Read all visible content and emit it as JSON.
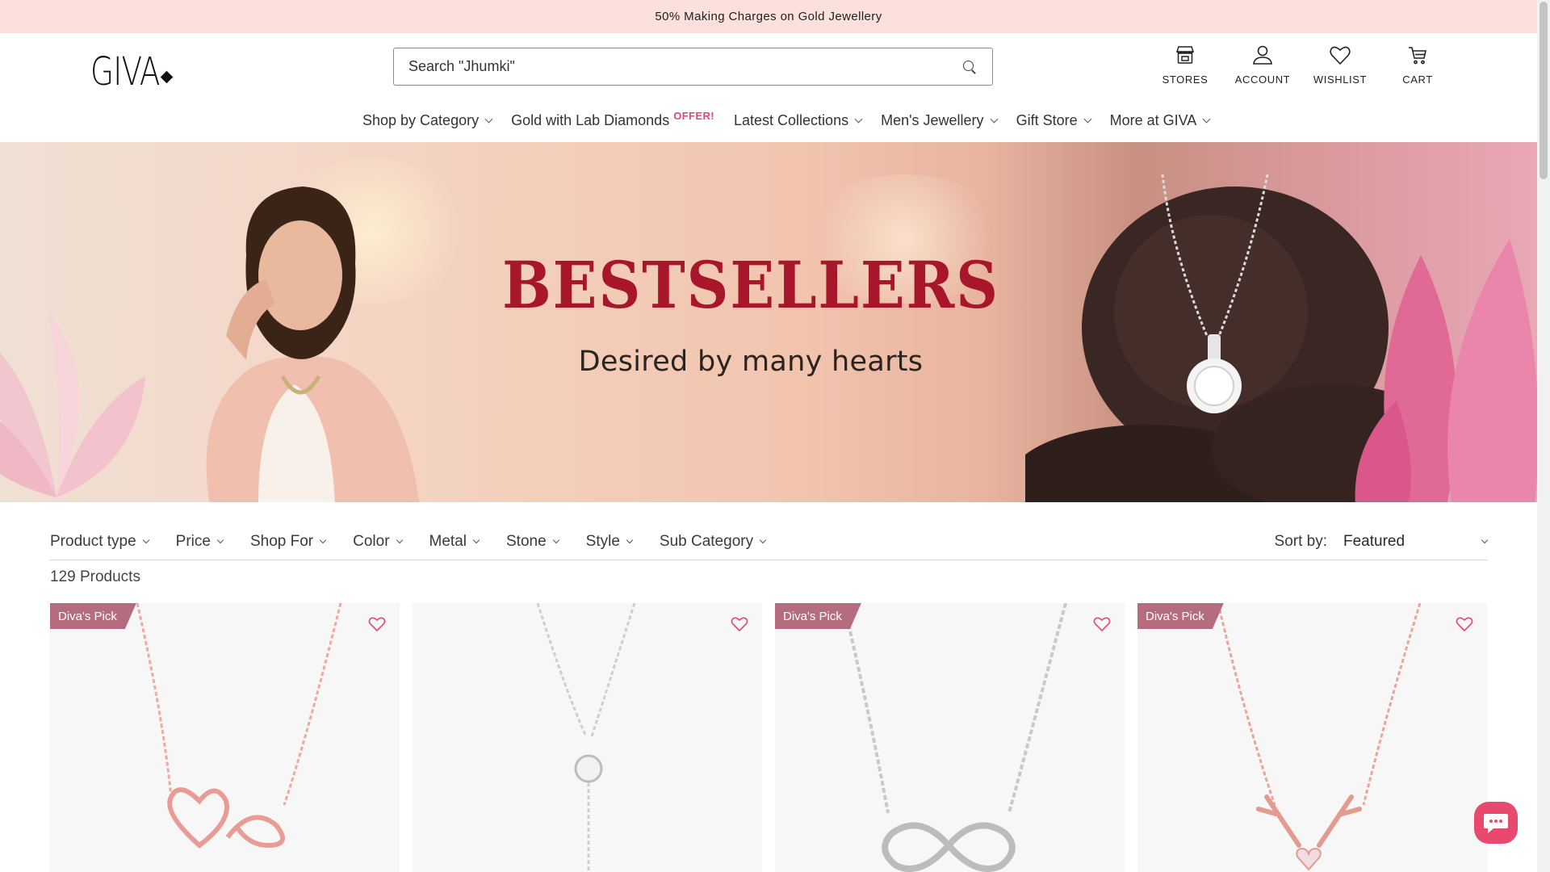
{
  "announcement": "50% Making Charges on Gold Jewellery",
  "brand": {
    "logo_text": "GIVA"
  },
  "search": {
    "placeholder": "Search \"Jhumki\""
  },
  "header_icons": [
    {
      "label": "STORES",
      "icon": "store-icon"
    },
    {
      "label": "ACCOUNT",
      "icon": "user-icon"
    },
    {
      "label": "WISHLIST",
      "icon": "heart-icon"
    },
    {
      "label": "CART",
      "icon": "cart-icon"
    }
  ],
  "nav": [
    {
      "label": "Shop by Category"
    },
    {
      "label": "Gold with Lab Diamonds",
      "tag": "OFFER!"
    },
    {
      "label": "Latest Collections"
    },
    {
      "label": "Men's Jewellery"
    },
    {
      "label": "Gift Store"
    },
    {
      "label": "More at GIVA"
    }
  ],
  "hero": {
    "title": "BESTSELLERS",
    "subtitle": "Desired by many hearts"
  },
  "filters": [
    "Product type",
    "Price",
    "Shop For",
    "Color",
    "Metal",
    "Stone",
    "Style",
    "Sub Category"
  ],
  "sort": {
    "label": "Sort by:",
    "value": "Featured"
  },
  "product_count": "129 Products",
  "products": [
    {
      "badge": "Diva's Pick",
      "metal": "rose-gold",
      "design": "heart-infinity"
    },
    {
      "badge": "",
      "metal": "silver",
      "design": "solitaire-drop"
    },
    {
      "badge": "Diva's Pick",
      "metal": "silver",
      "design": "infinity-hearts"
    },
    {
      "badge": "Diva's Pick",
      "metal": "rose-gold",
      "design": "antler-heart"
    }
  ],
  "colors": {
    "announce_bg": "#fbe0dc",
    "hero_title": "#a8162c",
    "badge": "#b56b80",
    "accent_pink": "#e0457b",
    "chat": "#e84a6f"
  }
}
